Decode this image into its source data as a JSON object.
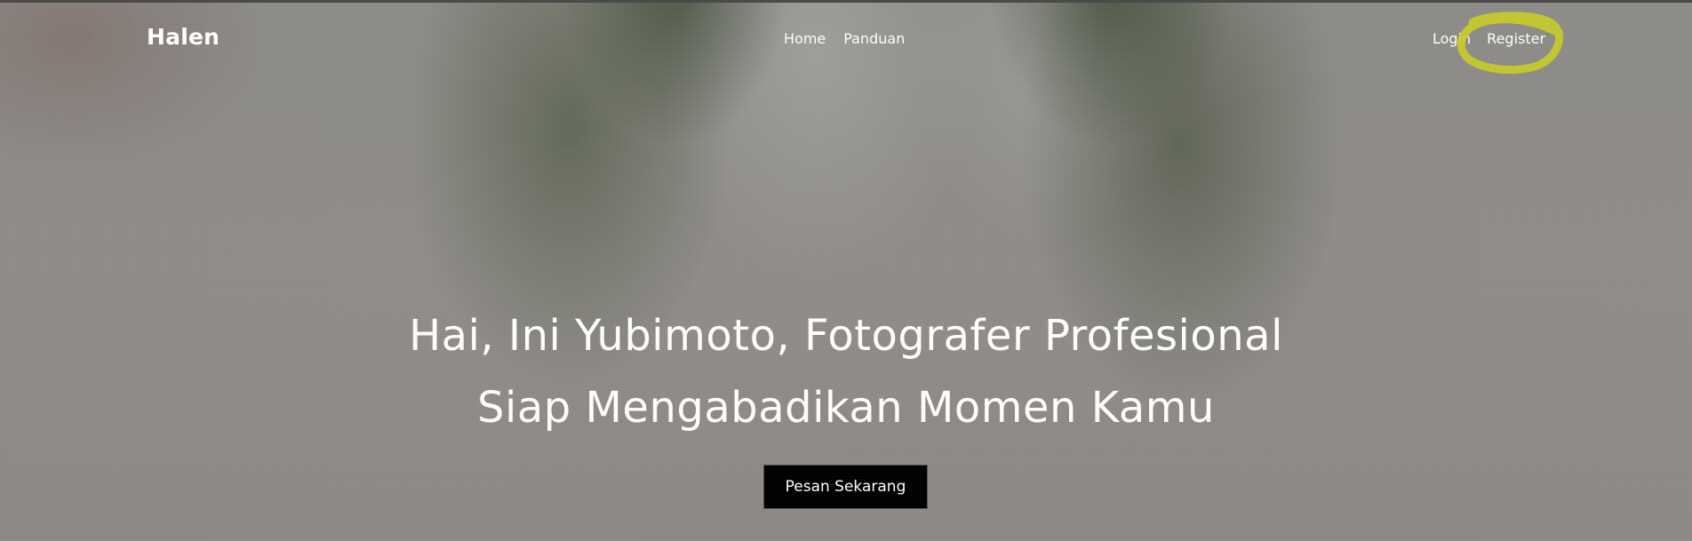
{
  "brand": {
    "name": "Halen"
  },
  "nav": {
    "center": [
      {
        "label": "Home"
      },
      {
        "label": "Panduan"
      }
    ],
    "auth": [
      {
        "label": "Login"
      },
      {
        "label": "Register"
      }
    ]
  },
  "hero": {
    "headline_line1": "Hai, Ini Yubimoto, Fotografer Profesional",
    "headline_line2": "Siap Mengabadikan Momen Kamu",
    "cta_label": "Pesan Sekarang"
  },
  "colors": {
    "text": "#ffffff",
    "cta_background": "#000000",
    "highlight_annotation": "#c8cc2a"
  }
}
